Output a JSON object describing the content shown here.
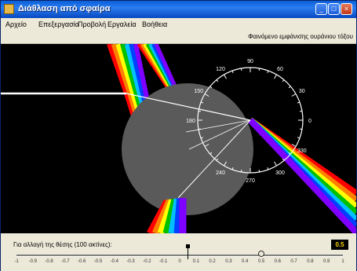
{
  "window": {
    "title": "Διάθλαση από σφαίρα"
  },
  "menu": {
    "items": [
      "Αρχείο",
      "Επεξεργασία",
      "Προβολή",
      "Εργαλεία",
      "Βοήθεια"
    ]
  },
  "toolbar": {
    "hint": "Φαινόμενο εμφάνισης ουράνιου τόξου"
  },
  "protractor": {
    "labels": [
      {
        "text": "60",
        "angle": 60
      },
      {
        "text": "90",
        "angle": 90
      },
      {
        "text": "120",
        "angle": 120
      },
      {
        "text": "150",
        "angle": 150
      },
      {
        "text": "180",
        "angle": 180
      },
      {
        "text": "240",
        "angle": 240
      },
      {
        "text": "270",
        "angle": 270
      },
      {
        "text": "300",
        "angle": 300
      },
      {
        "text": "330",
        "angle": 330
      },
      {
        "text": "0",
        "angle": 0
      },
      {
        "text": "30",
        "angle": 30
      }
    ]
  },
  "status": {
    "label": "Για αλλαγή της θέσης (100 ακτίνες):",
    "value": "0.5"
  },
  "slider": {
    "value": 0.5,
    "ticks": [
      "-1",
      "-0.9",
      "-0.8",
      "-0.7",
      "-0.6",
      "-0.5",
      "-0.4",
      "-0.3",
      "-0.2",
      "-0.1",
      "0",
      "0.1",
      "0.2",
      "0.3",
      "0.4",
      "0.5",
      "0.6",
      "0.7",
      "0.8",
      "0.9",
      "1"
    ]
  },
  "colors": {
    "spectrum": [
      "#ff0000",
      "#ff8000",
      "#ffff00",
      "#00c000",
      "#00c0ff",
      "#0040ff",
      "#8000ff"
    ],
    "sphere": "#5a5a5a",
    "title_bar": "#0a5fd8"
  }
}
